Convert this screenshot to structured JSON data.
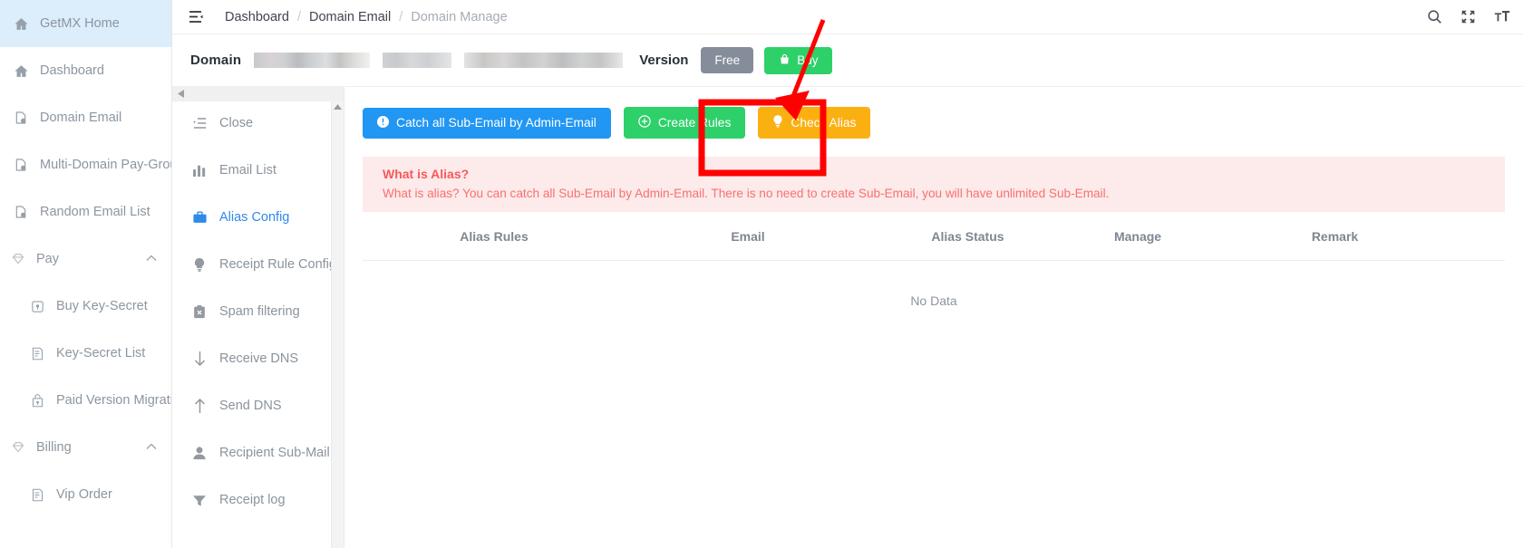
{
  "sidebar": {
    "items": [
      {
        "label": "GetMX Home",
        "icon": "home-icon",
        "active": true
      },
      {
        "label": "Dashboard",
        "icon": "home-icon",
        "active": false
      },
      {
        "label": "Domain Email",
        "icon": "domain-icon",
        "active": false
      },
      {
        "label": "Multi-Domain Pay-Group",
        "icon": "domain-icon",
        "active": false
      },
      {
        "label": "Random Email List",
        "icon": "domain-icon",
        "active": false
      }
    ],
    "groups": [
      {
        "label": "Pay",
        "icon": "diamond-icon",
        "chevron": "chevron-up-icon",
        "children": [
          {
            "label": "Buy Key-Secret",
            "icon": "key-box-icon"
          },
          {
            "label": "Key-Secret List",
            "icon": "list-doc-icon"
          },
          {
            "label": "Paid Version Migration",
            "icon": "upload-bag-icon"
          }
        ]
      },
      {
        "label": "Billing",
        "icon": "diamond-icon",
        "chevron": "chevron-up-icon",
        "children": [
          {
            "label": "Vip Order",
            "icon": "list-doc-icon"
          }
        ]
      }
    ]
  },
  "topbar": {
    "menu_toggle": "hamburger-icon",
    "breadcrumb": [
      {
        "label": "Dashboard",
        "muted": false
      },
      {
        "label": "Domain Email",
        "muted": false
      },
      {
        "label": "Domain Manage",
        "muted": true
      }
    ],
    "separator": "/",
    "icons": [
      "search-icon",
      "fullscreen-icon",
      "font-size-icon"
    ]
  },
  "domainbar": {
    "domain_label": "Domain",
    "domain_value_redacted": true,
    "version_label": "Version",
    "free_pill": "Free",
    "buy_button": "Buy",
    "buy_icon": "shopping-bag-icon"
  },
  "submenu": {
    "collapse_icon": "caret-left-icon",
    "scroll_up_icon": "caret-up-icon",
    "items": [
      {
        "label": "Close",
        "icon": "indent-list-icon",
        "active": false
      },
      {
        "label": "Email List",
        "icon": "bar-chart-icon",
        "active": false
      },
      {
        "label": "Alias Config",
        "icon": "briefcase-icon",
        "active": true
      },
      {
        "label": "Receipt Rule Config",
        "icon": "bulb-icon",
        "active": false
      },
      {
        "label": "Spam filtering",
        "icon": "clipboard-x-icon",
        "active": false
      },
      {
        "label": "Receive DNS",
        "icon": "arrow-down-icon",
        "active": false
      },
      {
        "label": "Send DNS",
        "icon": "arrow-up-icon",
        "active": false
      },
      {
        "label": "Recipient Sub-Mail",
        "icon": "user-icon",
        "active": false
      },
      {
        "label": "Receipt log",
        "icon": "funnel-icon",
        "active": false
      }
    ]
  },
  "main": {
    "buttons": [
      {
        "label": "Catch all Sub-Email by Admin-Email",
        "icon": "info-circle-icon",
        "color": "#2196f3"
      },
      {
        "label": "Create Rules",
        "icon": "plus-circle-icon",
        "color": "#2ed06a"
      },
      {
        "label": "Check Alias",
        "icon": "bulb-icon",
        "color": "#fbb012"
      }
    ],
    "alert": {
      "title": "What is Alias?",
      "text": "What is alias? You can catch all Sub-Email by Admin-Email. There is no need to create Sub-Email, you will have unlimited Sub-Email.",
      "bg": "#fdeaea",
      "fg": "#f76d6d"
    },
    "table": {
      "headers": [
        "Alias Rules",
        "Email",
        "Alias Status",
        "Manage",
        "Remark"
      ],
      "rows": [],
      "empty_text": "No Data"
    }
  },
  "annotation": {
    "color": "#ff0000",
    "highlight_target": "Check Alias",
    "shape": "arrow-and-box"
  }
}
